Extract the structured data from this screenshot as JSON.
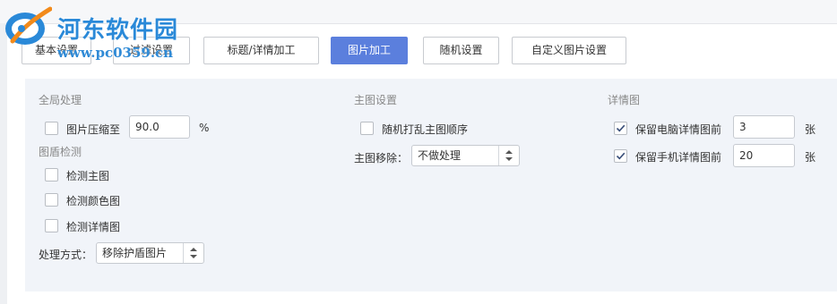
{
  "watermark": {
    "title": "河东软件园",
    "url": "www.pc0359.cn"
  },
  "tabs": [
    {
      "label": "基本设置",
      "active": false
    },
    {
      "label": "过滤设置",
      "active": false
    },
    {
      "label": "标题/详情加工",
      "active": false
    },
    {
      "label": "图片加工",
      "active": true
    },
    {
      "label": "随机设置",
      "active": false
    },
    {
      "label": "自定义图片设置",
      "active": false
    }
  ],
  "global": {
    "title": "全局处理",
    "compress_label": "图片压缩至",
    "compress_checked": false,
    "compress_value": "90.0",
    "compress_unit": "%"
  },
  "shield": {
    "title": "图盾检测",
    "checks": [
      {
        "label": "检测主图",
        "checked": false
      },
      {
        "label": "检测颜色图",
        "checked": false
      },
      {
        "label": "检测详情图",
        "checked": false
      }
    ],
    "method_label": "处理方式：",
    "method_value": "移除护盾图片"
  },
  "main_image": {
    "title": "主图设置",
    "shuffle_label": "随机打乱主图顺序",
    "shuffle_checked": false,
    "remove_label": "主图移除：",
    "remove_value": "不做处理"
  },
  "detail": {
    "title": "详情图",
    "pc_label": "保留电脑详情图前",
    "pc_checked": true,
    "pc_value": "3",
    "pc_unit": "张",
    "mobile_label": "保留手机详情图前",
    "mobile_checked": true,
    "mobile_value": "20",
    "mobile_unit": "张"
  },
  "colors": {
    "active_tab": "#5b7fdd",
    "panel_bg": "#f1f4f9",
    "watermark": "#2a89d8"
  }
}
